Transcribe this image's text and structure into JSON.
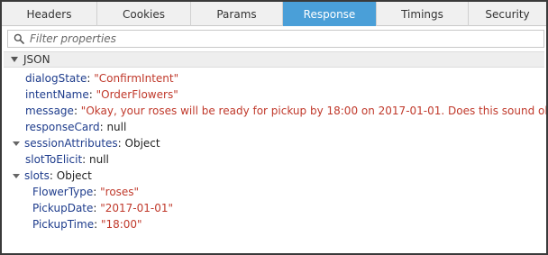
{
  "tabs": [
    {
      "label": "Headers",
      "active": false
    },
    {
      "label": "Cookies",
      "active": false
    },
    {
      "label": "Params",
      "active": false
    },
    {
      "label": "Response",
      "active": true
    },
    {
      "label": "Timings",
      "active": false
    },
    {
      "label": "Security",
      "active": false
    }
  ],
  "filter": {
    "placeholder": "Filter properties",
    "value": ""
  },
  "section": {
    "label": "JSON"
  },
  "json": {
    "dialogState": {
      "key": "dialogState",
      "value": "\"ConfirmIntent\""
    },
    "intentName": {
      "key": "intentName",
      "value": "\"OrderFlowers\""
    },
    "message": {
      "key": "message",
      "value": "\"Okay, your roses will be ready for pickup by 18:00 on 2017-01-01.  Does this sound okay?\""
    },
    "responseCard": {
      "key": "responseCard",
      "value": "null"
    },
    "sessionAttributes": {
      "key": "sessionAttributes",
      "value": "Object"
    },
    "slotToElicit": {
      "key": "slotToElicit",
      "value": "null"
    },
    "slots": {
      "key": "slots",
      "value": "Object",
      "children": {
        "FlowerType": {
          "key": "FlowerType",
          "value": "\"roses\""
        },
        "PickupDate": {
          "key": "PickupDate",
          "value": "\"2017-01-01\""
        },
        "PickupTime": {
          "key": "PickupTime",
          "value": "\"18:00\""
        }
      }
    }
  },
  "colors": {
    "active_tab": "#4a9fd8",
    "key": "#1e3c8c",
    "string": "#c0392b"
  }
}
